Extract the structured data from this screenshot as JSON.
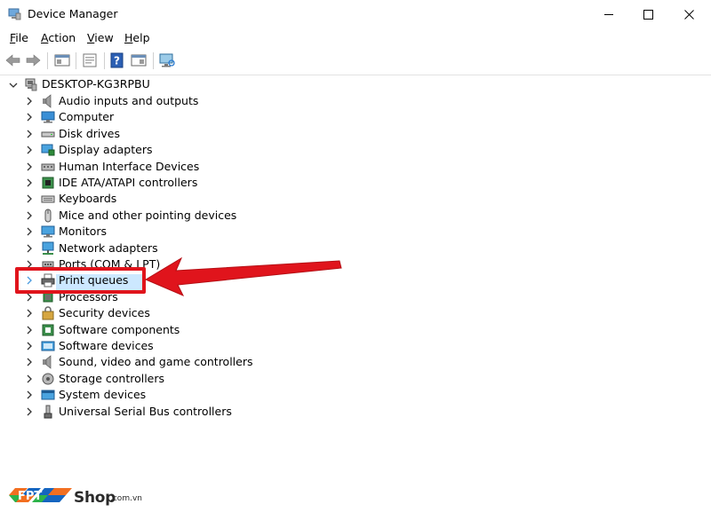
{
  "window": {
    "title": "Device Manager"
  },
  "menu": [
    {
      "label": "File",
      "key": "F",
      "rest": "ile"
    },
    {
      "label": "Action",
      "key": "A",
      "rest": "ction"
    },
    {
      "label": "View",
      "key": "V",
      "rest": "iew"
    },
    {
      "label": "Help",
      "key": "H",
      "rest": "elp"
    }
  ],
  "toolbar": {
    "icons": [
      "back-arrow-icon",
      "forward-arrow-icon",
      "show-hide-console-tree-icon",
      "properties-icon",
      "help-icon",
      "action-pane-icon",
      "scan-hardware-changes-icon"
    ]
  },
  "tree": {
    "root": "DESKTOP-KG3RPBU",
    "items": [
      {
        "label": "Audio inputs and outputs",
        "icon": "speaker-icon"
      },
      {
        "label": "Computer",
        "icon": "computer-icon"
      },
      {
        "label": "Disk drives",
        "icon": "disk-drive-icon"
      },
      {
        "label": "Display adapters",
        "icon": "display-adapter-icon"
      },
      {
        "label": "Human Interface Devices",
        "icon": "hid-icon"
      },
      {
        "label": "IDE ATA/ATAPI controllers",
        "icon": "ide-controller-icon"
      },
      {
        "label": "Keyboards",
        "icon": "keyboard-icon"
      },
      {
        "label": "Mice and other pointing devices",
        "icon": "mouse-icon"
      },
      {
        "label": "Monitors",
        "icon": "monitor-icon"
      },
      {
        "label": "Network adapters",
        "icon": "network-adapter-icon"
      },
      {
        "label": "Ports (COM & LPT)",
        "icon": "port-icon"
      },
      {
        "label": "Print queues",
        "icon": "printer-icon",
        "selected": true
      },
      {
        "label": "Processors",
        "icon": "processor-icon"
      },
      {
        "label": "Security devices",
        "icon": "security-device-icon"
      },
      {
        "label": "Software components",
        "icon": "software-component-icon"
      },
      {
        "label": "Software devices",
        "icon": "software-device-icon"
      },
      {
        "label": "Sound, video and game controllers",
        "icon": "sound-controller-icon"
      },
      {
        "label": "Storage controllers",
        "icon": "storage-controller-icon"
      },
      {
        "label": "System devices",
        "icon": "system-device-icon"
      },
      {
        "label": "Universal Serial Bus controllers",
        "icon": "usb-icon"
      }
    ]
  },
  "watermark": {
    "brand": "FPT",
    "shop": "Shop",
    "domain": ".com.vn"
  },
  "colors": {
    "selection": "#cce8ff",
    "annotation_red": "#e0141c",
    "fpt_blue": "#1565c0",
    "fpt_orange": "#f26f21",
    "fpt_green": "#2db34a"
  }
}
